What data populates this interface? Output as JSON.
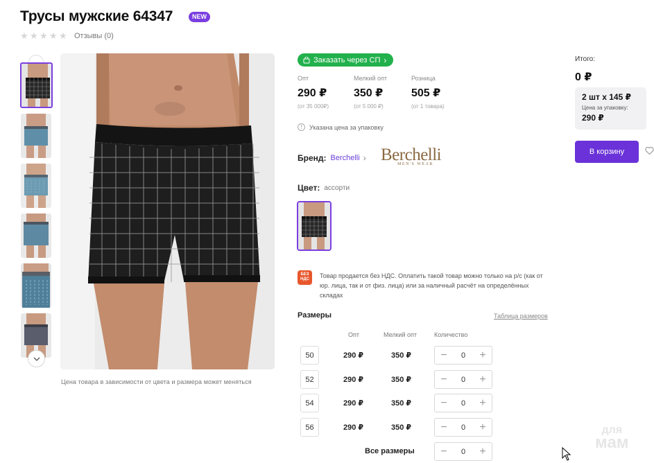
{
  "product": {
    "title": "Трусы мужские 64347",
    "badge": "NEW",
    "reviews": "Отзывы (0)",
    "rating_stars": 0,
    "price_disclaimer": "Цена товара в зависимости от цвета и размера может меняться"
  },
  "thumbnails": [
    {
      "name": "thumb-black-check",
      "color": "#2a2a2a"
    },
    {
      "name": "thumb-blue-1",
      "color": "#5f8fa8"
    },
    {
      "name": "thumb-blue-2",
      "color": "#6c9bb2"
    },
    {
      "name": "thumb-blue-3",
      "color": "#5d8aa2"
    },
    {
      "name": "thumb-blue-4",
      "color": "#4f7f99"
    },
    {
      "name": "thumb-gray",
      "color": "#5a5d6b"
    }
  ],
  "order": {
    "sp_button": "Заказать через СП",
    "prices": [
      {
        "label": "Опт",
        "value": "290 ₽",
        "note": "(от 35 000₽)"
      },
      {
        "label": "Мелкий опт",
        "value": "350 ₽",
        "note": "(от 5 000 ₽)"
      },
      {
        "label": "Розница",
        "value": "505 ₽",
        "note": "(от 1 товара)"
      }
    ],
    "price_info": "Указана цена за упаковку"
  },
  "brand": {
    "label": "Бренд:",
    "name": "Berchelli",
    "logo_text": "Berchelli",
    "logo_sub": "MEN'S WEAR"
  },
  "color": {
    "label": "Цвет:",
    "value": "ассорти"
  },
  "vat": {
    "icon_text": "БЕЗ НДС",
    "text": "Товар продается без НДС. Оплатить такой товар можно только на р/с (как от юр. лица, так и от физ. лица) или за наличный расчёт на определённых складах"
  },
  "sizes": {
    "title": "Размеры",
    "table_link": "Таблица размеров",
    "headers": {
      "opt": "Опт",
      "small_opt": "Мелкий опт",
      "qty": "Количество"
    },
    "rows": [
      {
        "size": "50",
        "opt": "290 ₽",
        "small_opt": "350 ₽",
        "qty": "0"
      },
      {
        "size": "52",
        "opt": "290 ₽",
        "small_opt": "350 ₽",
        "qty": "0"
      },
      {
        "size": "54",
        "opt": "290 ₽",
        "small_opt": "350 ₽",
        "qty": "0"
      },
      {
        "size": "56",
        "opt": "290 ₽",
        "small_opt": "350 ₽",
        "qty": "0"
      }
    ],
    "all_label": "Все размеры",
    "all_qty": "0"
  },
  "summary": {
    "total_label": "Итого:",
    "total_value": "0 ₽",
    "pack_main": "2 шт х 145 ₽",
    "pack_label": "Цена за упаковку:",
    "pack_price": "290 ₽",
    "cart_button": "В корзину"
  },
  "watermark": {
    "line1": "для",
    "line2": "мам"
  },
  "colors": {
    "accent": "#7a3ee0",
    "cart": "#6a32d8",
    "sp_green": "#22b14c",
    "vat_red": "#e8562c"
  }
}
